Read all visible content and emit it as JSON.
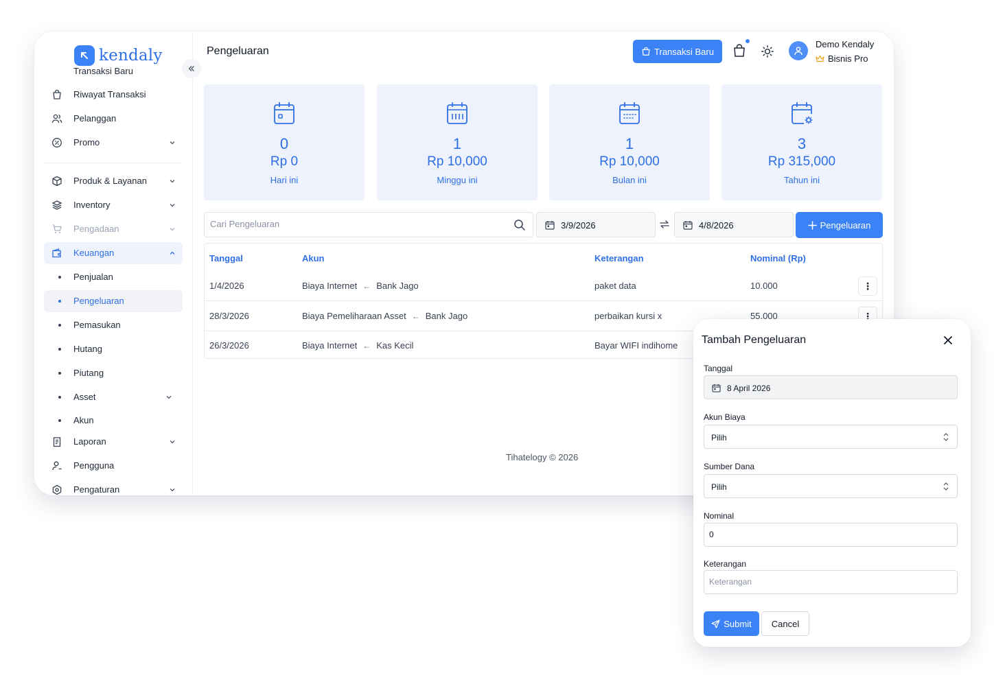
{
  "brand": {
    "name": "kendaly",
    "color": "#3b82f6"
  },
  "sidebar": {
    "cut_item": "Transaksi Baru",
    "items": [
      {
        "label": "Riwayat Transaksi",
        "icon": "shopping-bag-icon"
      },
      {
        "label": "Pelanggan",
        "icon": "users-icon"
      },
      {
        "label": "Promo",
        "icon": "discount-icon"
      },
      {
        "label": "Produk & Layanan",
        "icon": "box-icon"
      },
      {
        "label": "Inventory",
        "icon": "layers-icon"
      },
      {
        "label": "Pengadaan",
        "icon": "cart-icon"
      },
      {
        "label": "Keuangan",
        "icon": "wallet-icon"
      },
      {
        "label": "Penjualan"
      },
      {
        "label": "Pengeluaran"
      },
      {
        "label": "Pemasukan"
      },
      {
        "label": "Hutang"
      },
      {
        "label": "Piutang"
      },
      {
        "label": "Asset"
      },
      {
        "label": "Akun"
      },
      {
        "label": "Laporan",
        "icon": "clipboard-icon"
      },
      {
        "label": "Pengguna",
        "icon": "user-icon"
      },
      {
        "label": "Pengaturan",
        "icon": "settings-icon"
      }
    ]
  },
  "header": {
    "title": "Pengeluaran",
    "new_transaction": "Transaksi Baru",
    "user_name": "Demo Kendaly",
    "user_plan": "Bisnis Pro"
  },
  "stats": [
    {
      "count": "0",
      "amount": "Rp 0",
      "label": "Hari ini"
    },
    {
      "count": "1",
      "amount": "Rp 10,000",
      "label": "Minggu ini"
    },
    {
      "count": "1",
      "amount": "Rp 10,000",
      "label": "Bulan ini"
    },
    {
      "count": "3",
      "amount": "Rp 315,000",
      "label": "Tahun ini"
    }
  ],
  "filters": {
    "search_placeholder": "Cari Pengeluaran",
    "date_from": "3/9/2026",
    "date_to": "4/8/2026",
    "add_button": "Pengeluaran"
  },
  "table": {
    "columns": [
      "Tanggal",
      "Akun",
      "Keterangan",
      "Nominal (Rp)"
    ],
    "rows": [
      {
        "tanggal": "1/4/2026",
        "akun_to": "Biaya Internet",
        "akun_from": "Bank Jago",
        "keterangan": "paket data",
        "nominal": "10.000"
      },
      {
        "tanggal": "28/3/2026",
        "akun_to": "Biaya Pemeliharaan Asset",
        "akun_from": "Bank Jago",
        "keterangan": "perbaikan kursi x",
        "nominal": "55.000"
      },
      {
        "tanggal": "26/3/2026",
        "akun_to": "Biaya Internet",
        "akun_from": "Kas Kecil",
        "keterangan": "Bayar WIFI indihome",
        "nominal": ""
      }
    ]
  },
  "footer": "Tihatelogy © 2026",
  "modal": {
    "title": "Tambah Pengeluaran",
    "tanggal_label": "Tanggal",
    "tanggal_value": "8 April 2026",
    "akun_biaya_label": "Akun Biaya",
    "akun_biaya_value": "Pilih",
    "sumber_dana_label": "Sumber Dana",
    "sumber_dana_value": "Pilih",
    "nominal_label": "Nominal",
    "nominal_value": "0",
    "keterangan_label": "Keterangan",
    "keterangan_placeholder": "Keterangan",
    "submit": "Submit",
    "cancel": "Cancel"
  }
}
